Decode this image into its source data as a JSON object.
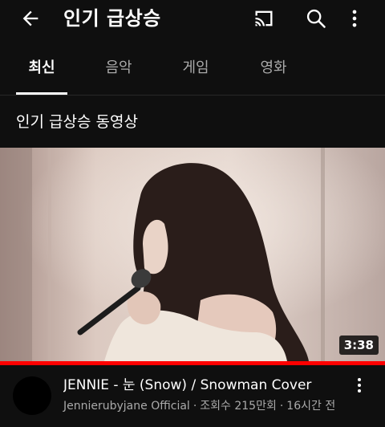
{
  "appbar": {
    "title": "인기 급상승",
    "icons": {
      "back": "arrow-back-icon",
      "cast": "cast-icon",
      "search": "search-icon",
      "more": "more-vertical-icon"
    }
  },
  "tabs": [
    {
      "label": "최신",
      "active": true
    },
    {
      "label": "음악",
      "active": false
    },
    {
      "label": "게임",
      "active": false
    },
    {
      "label": "영화",
      "active": false
    }
  ],
  "section": {
    "title": "인기 급상승 동영상"
  },
  "video": {
    "duration": "3:38",
    "progress_fraction": 1.0,
    "title": "JENNIE - 눈 (Snow) / Snowman Cover",
    "channel": "Jennierubyjane Official",
    "views": "조회수 215만회",
    "age": "16시간 전",
    "separator": "·"
  },
  "colors": {
    "background": "#0f0f0f",
    "progress": "#ff0000",
    "text_primary": "#ffffff",
    "text_secondary": "#aaaaaa"
  }
}
